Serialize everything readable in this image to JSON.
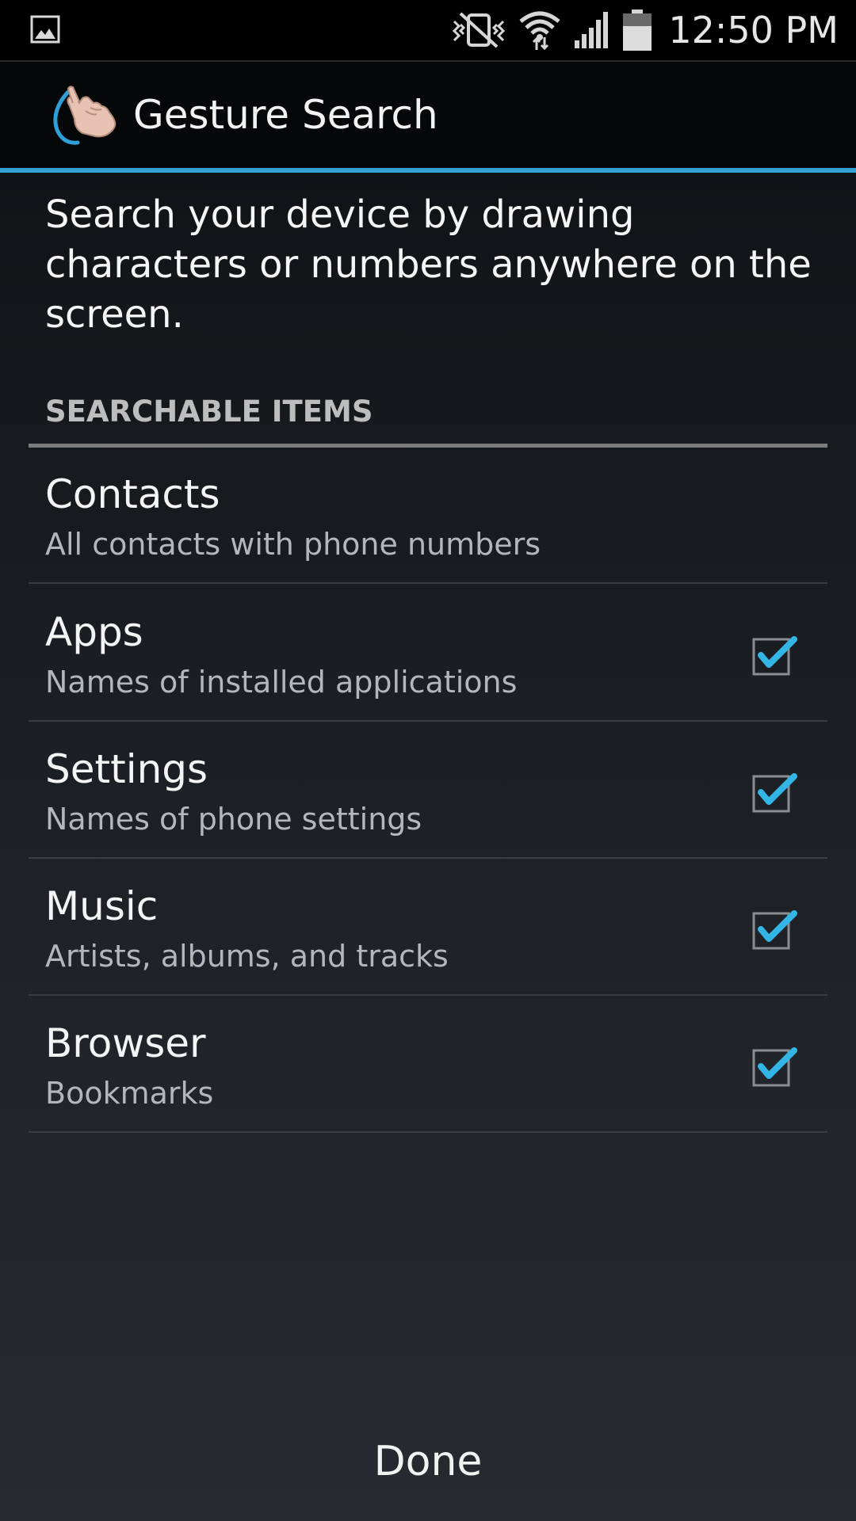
{
  "status_bar": {
    "time": "12:50 PM",
    "icons": [
      "gallery-notification-icon",
      "vibrate-mute-icon",
      "wifi-icon",
      "cell-signal-icon",
      "battery-icon"
    ]
  },
  "action_bar": {
    "title": "Gesture Search",
    "icon": "gesture-hand-icon",
    "accent_color": "#33a3d6"
  },
  "description": "Search your device by drawing characters or numbers anywhere on the screen.",
  "section": {
    "header": "SEARCHABLE ITEMS"
  },
  "items": [
    {
      "title": "Contacts",
      "subtitle": "All contacts with phone numbers",
      "has_checkbox": false
    },
    {
      "title": "Apps",
      "subtitle": "Names of installed applications",
      "has_checkbox": true,
      "checked": true
    },
    {
      "title": "Settings",
      "subtitle": "Names of phone settings",
      "has_checkbox": true,
      "checked": true
    },
    {
      "title": "Music",
      "subtitle": "Artists, albums, and tracks",
      "has_checkbox": true,
      "checked": true
    },
    {
      "title": "Browser",
      "subtitle": "Bookmarks",
      "has_checkbox": true,
      "checked": true
    }
  ],
  "footer": {
    "done_label": "Done"
  }
}
